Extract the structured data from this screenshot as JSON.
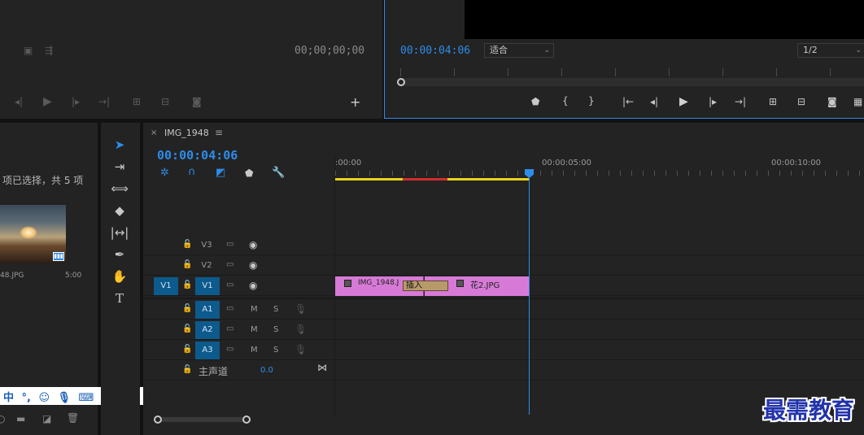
{
  "source_monitor": {
    "timecode": "00;00;00;00"
  },
  "program_monitor": {
    "timecode": "00:00:04:06",
    "fit_select": "适合",
    "resolution_select": "1/2"
  },
  "project_panel": {
    "status": "项已选择，共 5 项",
    "item_name": "48.JPG",
    "item_duration": "5:00"
  },
  "ime_toolbar": {
    "chinese_mode": "中",
    "punct": "°,"
  },
  "timeline": {
    "tab_title": "IMG_1948",
    "timecode": "00:00:04:06",
    "ruler": [
      ":00:00",
      "00:00:05:00",
      "00:00:10:00"
    ],
    "tracks_video": [
      {
        "label": "V3"
      },
      {
        "label": "V2"
      },
      {
        "label": "V1",
        "source": "V1"
      }
    ],
    "tracks_audio": [
      {
        "label": "A1",
        "m": "M",
        "s": "S"
      },
      {
        "label": "A2",
        "m": "M",
        "s": "S"
      },
      {
        "label": "A3",
        "m": "M",
        "s": "S"
      }
    ],
    "master": {
      "label": "主声道",
      "value": "0.0"
    },
    "clips": {
      "clip1": "IMG_1948.J",
      "tooltip": "插入",
      "clip2": "花2.JPG",
      "color": "#d77ad7"
    }
  },
  "watermark": "最需教育",
  "colors": {
    "accent": "#2d8ceb",
    "track_selected": "#0d5a8c",
    "work_area": "#e8d21f",
    "render_red": "#d12c2c"
  }
}
